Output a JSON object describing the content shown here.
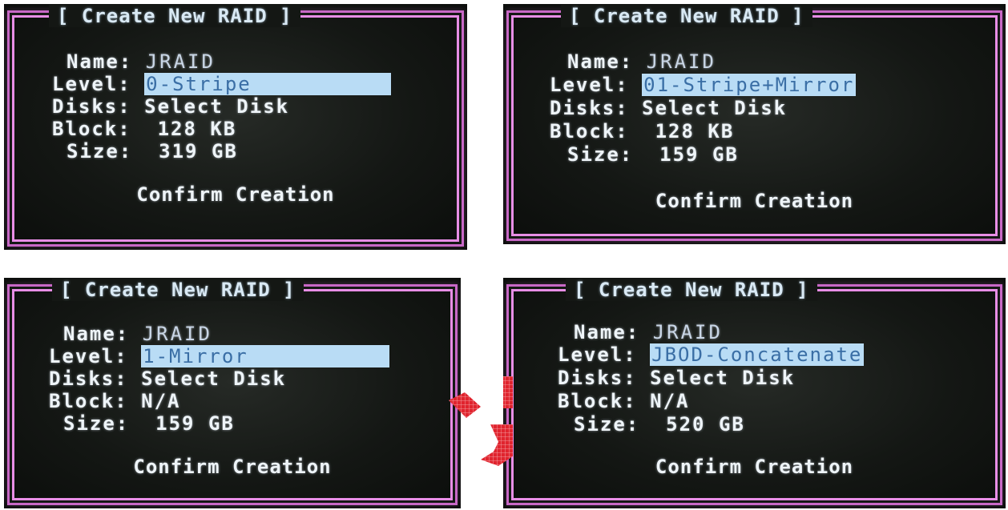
{
  "screens": [
    {
      "title": "[ Create New RAID ]",
      "fields": {
        "name_label": "Name:",
        "name_value": "JRAID",
        "level_label": "Level:",
        "level_value": "0-Stripe",
        "disks_label": "Disks:",
        "disks_value": "Select Disk",
        "block_label": "Block:",
        "block_value": "128 KB",
        "size_label": "Size:",
        "size_value": "319 GB"
      },
      "confirm": "Confirm Creation"
    },
    {
      "title": "[ Create New RAID ]",
      "fields": {
        "name_label": "Name:",
        "name_value": "JRAID",
        "level_label": "Level:",
        "level_value": "01-Stripe+Mirror",
        "disks_label": "Disks:",
        "disks_value": "Select Disk",
        "block_label": "Block:",
        "block_value": "128 KB",
        "size_label": "Size:",
        "size_value": "159 GB"
      },
      "confirm": "Confirm Creation"
    },
    {
      "title": "[ Create New RAID ]",
      "fields": {
        "name_label": "Name:",
        "name_value": "JRAID",
        "level_label": "Level:",
        "level_value": "1-Mirror",
        "disks_label": "Disks:",
        "disks_value": "Select Disk",
        "block_label": "Block:",
        "block_value": "N/A",
        "size_label": "Size:",
        "size_value": "159 GB"
      },
      "confirm": "Confirm Creation"
    },
    {
      "title": "[ Create New RAID ]",
      "fields": {
        "name_label": "Name:",
        "name_value": "JRAID",
        "level_label": "Level:",
        "level_value": "JBOD-Concatenate",
        "disks_label": "Disks:",
        "disks_value": "Select Disk",
        "block_label": "Block:",
        "block_value": "N/A",
        "size_label": "Size:",
        "size_value": "520 GB"
      },
      "confirm": "Confirm Creation"
    }
  ],
  "colors": {
    "border": "#e88ee6",
    "selection_bg": "#b9dcf5",
    "selection_text": "#3a6ea5",
    "watermark": "#e0242e"
  }
}
